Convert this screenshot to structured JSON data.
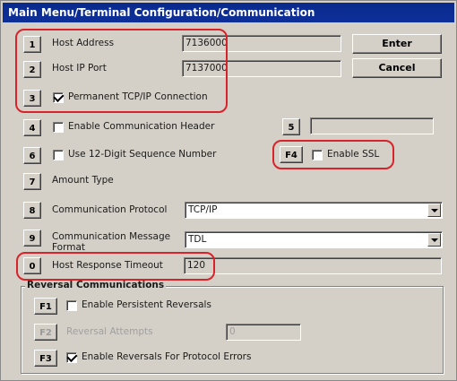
{
  "window": {
    "title": "Main Menu/Terminal Configuration/Communication"
  },
  "rows": {
    "host_address": {
      "key": "1",
      "label": "Host Address",
      "value": "7136000"
    },
    "host_ip_port": {
      "key": "2",
      "label": "Host IP Port",
      "value": "7137000"
    },
    "permanent_tcp": {
      "key": "3",
      "label": "Permanent TCP/IP Connection",
      "checked": true
    },
    "comm_header": {
      "key": "4",
      "label": "Enable Communication Header",
      "checked": false
    },
    "field5": {
      "key": "5",
      "value": ""
    },
    "seq_number": {
      "key": "6",
      "label": "Use 12-Digit Sequence Number",
      "checked": false
    },
    "ssl": {
      "key": "F4",
      "label": "Enable SSL",
      "checked": false
    },
    "amount_type": {
      "key": "7",
      "label": "Amount Type"
    },
    "comm_protocol": {
      "key": "8",
      "label": "Communication Protocol",
      "value": "TCP/IP"
    },
    "comm_message_format": {
      "key": "9",
      "label": "Communication Message Format",
      "value": "TDL"
    },
    "host_timeout": {
      "key": "0",
      "label": "Host Response Timeout",
      "value": "120"
    }
  },
  "buttons": {
    "enter": "Enter",
    "cancel": "Cancel"
  },
  "reversal": {
    "title": "Reversal Communications",
    "persistent": {
      "key": "F1",
      "label": "Enable Persistent Reversals",
      "checked": false
    },
    "attempts": {
      "key": "F2",
      "label": "Reversal Attempts",
      "value": "0",
      "disabled": true
    },
    "protocol_errors": {
      "key": "F3",
      "label": "Enable Reversals For Protocol Errors",
      "checked": true
    }
  },
  "icons": {
    "checkbox_checked": "check-mark-icon",
    "dropdown": "chevron-down-icon"
  },
  "colors": {
    "title_bar": "#0d2f99",
    "highlight": "#d8232a",
    "window_bg": "#d4d0c8"
  }
}
